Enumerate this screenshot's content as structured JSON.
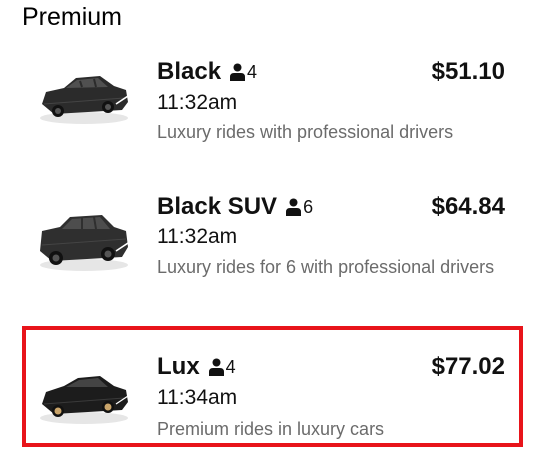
{
  "section": {
    "title": "Premium"
  },
  "rides": [
    {
      "name": "Black",
      "capacity": "4",
      "price": "$51.10",
      "eta": "11:32am",
      "description": "Luxury rides with professional drivers",
      "icon": "sedan-car-icon",
      "selected": false
    },
    {
      "name": "Black SUV",
      "capacity": "6",
      "price": "$64.84",
      "eta": "11:32am",
      "description": "Luxury rides for 6 with professional drivers",
      "icon": "suv-car-icon",
      "selected": false
    },
    {
      "name": "Lux",
      "capacity": "4",
      "price": "$77.02",
      "eta": "11:34am",
      "description": "Premium rides in luxury cars",
      "icon": "luxury-car-icon",
      "selected": true
    }
  ],
  "colors": {
    "selection_border": "#e8141a",
    "description_text": "#6b6b6b",
    "primary_text": "#111111"
  }
}
